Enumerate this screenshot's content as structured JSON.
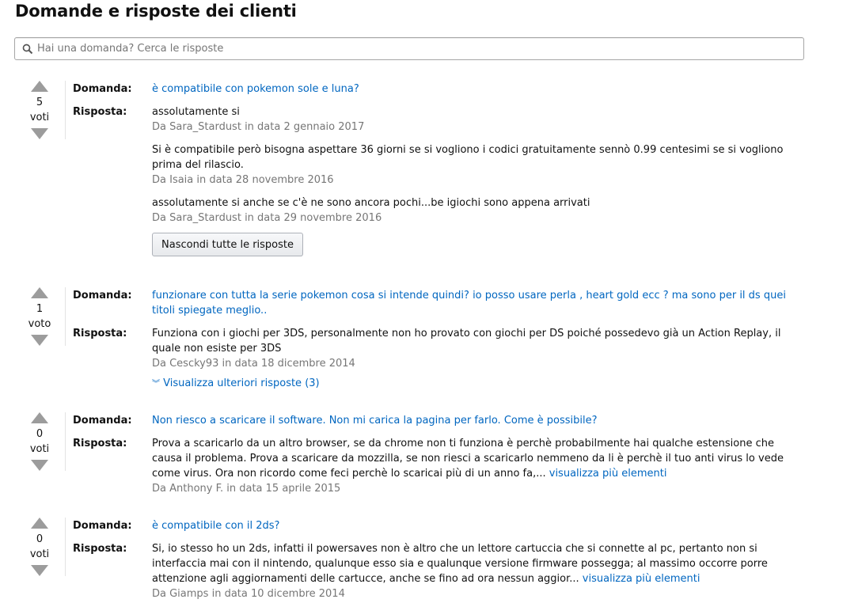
{
  "page_title": "Domande e risposte dei clienti",
  "search": {
    "placeholder": "Hai una domanda? Cerca le risposte",
    "value": ""
  },
  "labels": {
    "question": "Domanda:",
    "answer": "Risposta:"
  },
  "icons": {
    "search": "search-icon",
    "vote_up": "triangle-up-icon",
    "vote_down": "triangle-down-icon",
    "expand": "double-chevron-down-icon"
  },
  "colors": {
    "link": "#0066c0",
    "meta": "#767676",
    "vote_arrow": "#9c9c9c"
  },
  "questions": [
    {
      "votes": "5",
      "vote_unit": "voti",
      "question": "è compatibile con pokemon sole e luna?",
      "answers": [
        {
          "text": "assolutamente si",
          "meta": "Da Sara_Stardust in data 2 gennaio 2017"
        },
        {
          "text": "Si è compatibile però bisogna aspettare 36 giorni se si vogliono i codici gratuitamente sennò 0.99 centesimi se si vogliono prima del rilascio.",
          "meta": "Da Isaia in data 28 novembre 2016"
        },
        {
          "text": "assolutamente si anche se c'è ne sono ancora pochi...be igiochi sono appena arrivati",
          "meta": "Da Sara_Stardust in data 29 novembre 2016"
        }
      ],
      "hide_button": "Nascondi tutte le risposte"
    },
    {
      "votes": "1",
      "vote_unit": "voto",
      "question": "funzionare con tutta la serie pokemon cosa si intende quindi? io posso usare perla , heart gold ecc ? ma sono per il ds quei titoli spiegate meglio..",
      "answers": [
        {
          "text": "Funziona con i giochi per 3DS, personalmente non ho provato con giochi per DS poiché possedevo già un Action Replay, il quale non esiste per 3DS",
          "meta": "Da Cescky93 in data 18 dicembre 2014"
        }
      ],
      "more_answers": "Visualizza ulteriori risposte (3)"
    },
    {
      "votes": "0",
      "vote_unit": "voti",
      "question": "Non riesco a scaricare il software. Non mi carica la pagina per farlo. Come è possibile?",
      "answers": [
        {
          "text": "Prova a scaricarlo da un altro browser, se da chrome non ti funziona è perchè probabilmente hai qualche estensione che causa il problema. Prova a scaricare da mozzilla, se non riesci a scaricarlo nemmeno da li è perchè il tuo anti virus lo vede come virus. Ora non ricordo come feci perchè lo scaricai più di un anno fa,...",
          "see_more": "visualizza più elementi",
          "meta": "Da Anthony F. in data 15 aprile 2015"
        }
      ]
    },
    {
      "votes": "0",
      "vote_unit": "voti",
      "question": "è compatibile con il 2ds?",
      "answers": [
        {
          "text": "Si, io stesso ho un 2ds, infatti il powersaves non è altro che un lettore cartuccia che si connette al pc, pertanto non si interfaccia mai con il nintendo, qualunque esso sia e qualunque versione firmware possegga; al massimo occorre porre attenzione agli aggiornamenti delle cartucce, anche se fino ad ora nessun aggior...",
          "see_more": "visualizza più elementi",
          "meta": "Da Giamps in data 10 dicembre 2014"
        }
      ]
    }
  ]
}
